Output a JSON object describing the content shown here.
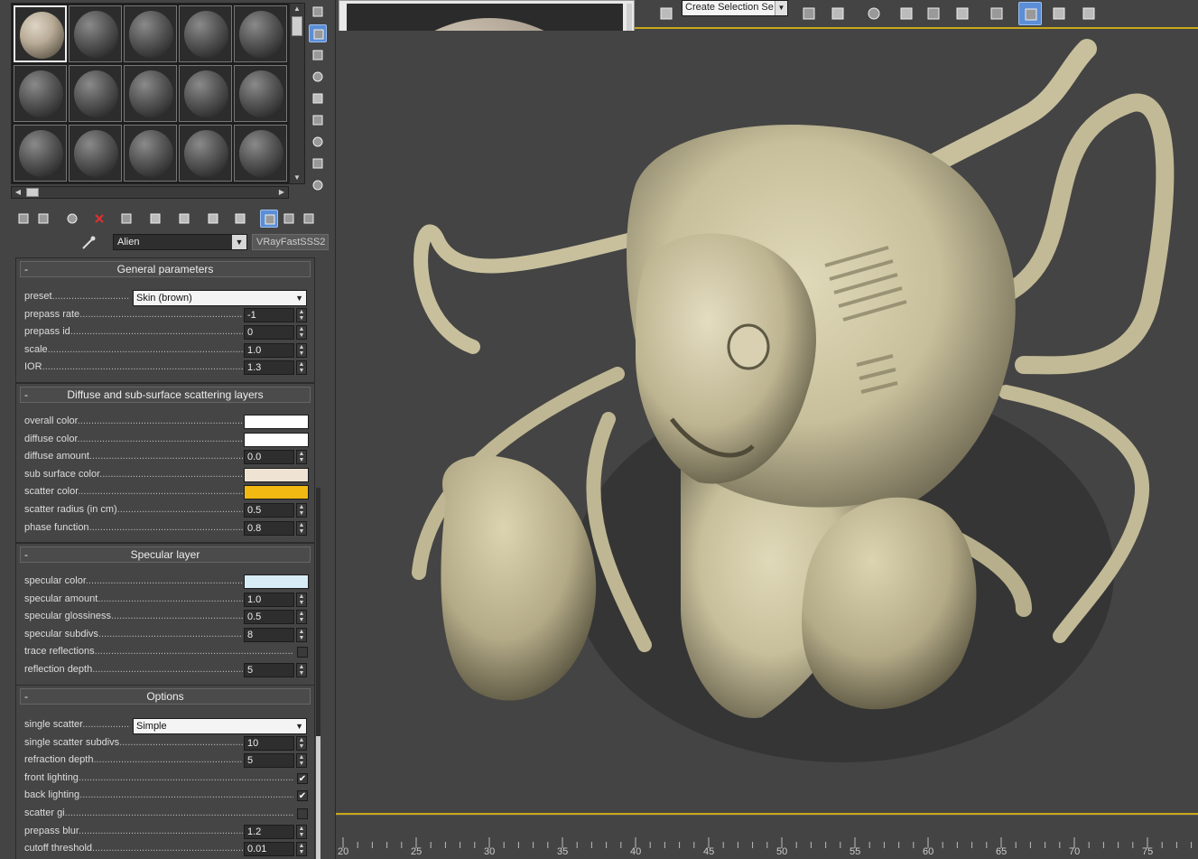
{
  "material": {
    "name": "Alien",
    "type": "VRayFastSSS2"
  },
  "rollouts": [
    {
      "title": "General parameters",
      "params": [
        {
          "label": "preset",
          "kind": "combo",
          "value": "Skin (brown)"
        },
        {
          "label": "prepass rate",
          "kind": "spinner",
          "value": "-1"
        },
        {
          "label": "prepass id",
          "kind": "spinner",
          "value": "0"
        },
        {
          "label": "scale",
          "kind": "spinner",
          "value": "1.0"
        },
        {
          "label": "IOR",
          "kind": "spinner",
          "value": "1.3"
        }
      ]
    },
    {
      "title": "Diffuse and sub-surface scattering layers",
      "params": [
        {
          "label": "overall color",
          "kind": "color",
          "color": "#ffffff"
        },
        {
          "label": "diffuse color",
          "kind": "color",
          "color": "#ffffff"
        },
        {
          "label": "diffuse amount",
          "kind": "spinner",
          "value": "0.0"
        },
        {
          "label": "sub surface color",
          "kind": "color",
          "color": "#efe3d4"
        },
        {
          "label": "scatter color",
          "kind": "color",
          "color": "#f1b912"
        },
        {
          "label": "scatter radius (in cm)",
          "kind": "spinner",
          "value": "0.5"
        },
        {
          "label": "phase function",
          "kind": "spinner",
          "value": "0.8"
        }
      ]
    },
    {
      "title": "Specular layer",
      "params": [
        {
          "label": "specular color",
          "kind": "color",
          "color": "#d8ecf6"
        },
        {
          "label": "specular amount",
          "kind": "spinner",
          "value": "1.0"
        },
        {
          "label": "specular glossiness",
          "kind": "spinner",
          "value": "0.5"
        },
        {
          "label": "specular subdivs",
          "kind": "spinner",
          "value": "8"
        },
        {
          "label": "trace reflections",
          "kind": "checkbox",
          "checked": false
        },
        {
          "label": "reflection depth",
          "kind": "spinner",
          "value": "5"
        }
      ]
    },
    {
      "title": "Options",
      "params": [
        {
          "label": "single scatter",
          "kind": "combo",
          "value": "Simple"
        },
        {
          "label": "single scatter subdivs",
          "kind": "spinner",
          "value": "10"
        },
        {
          "label": "refraction depth",
          "kind": "spinner",
          "value": "5"
        },
        {
          "label": "front lighting",
          "kind": "checkbox",
          "checked": true
        },
        {
          "label": "back lighting",
          "kind": "checkbox",
          "checked": true
        },
        {
          "label": "scatter gi",
          "kind": "checkbox",
          "checked": false
        },
        {
          "label": "prepass blur",
          "kind": "spinner",
          "value": "1.2"
        },
        {
          "label": "cutoff threshold",
          "kind": "spinner",
          "value": "0.01"
        }
      ]
    }
  ],
  "toolbar": {
    "selection_set_placeholder": "Create Selection Se",
    "collapse_label": "-"
  },
  "timeline": {
    "labels": [
      "20",
      "25",
      "30",
      "35",
      "40",
      "45",
      "50",
      "55",
      "60",
      "65",
      "70",
      "75"
    ]
  },
  "colors": {
    "accent_yellow": "#c9a818",
    "active_blue": "#5b8ed6",
    "creature": "#cfc7a6"
  },
  "icons": {
    "side_tools": [
      "sample-type-sphere-icon",
      "backlight-icon",
      "background-checker-icon",
      "sample-uv-tiling-icon",
      "video-color-check-icon",
      "make-preview-icon",
      "options-icon",
      "select-by-material-icon",
      "material-map-navigator-icon"
    ],
    "material_tools": [
      "get-material-icon",
      "put-to-scene-icon",
      "assign-to-selection-icon",
      "reset-map-icon",
      "make-copy-icon",
      "make-unique-icon",
      "put-to-library-icon",
      "material-id-icon",
      "show-shaded-material-icon",
      "show-end-result-icon",
      "go-to-parent-icon",
      "go-forward-sibling-icon"
    ],
    "toolbar": [
      "edit-named-selection-icon",
      "mirror-icon",
      "align-icon",
      "manage-layers-icon",
      "scene-explorer-icon",
      "curve-editor-icon",
      "schematic-view-icon",
      "material-editor-icon",
      "render-setup-icon",
      "rendered-frame-icon",
      "render-production-icon"
    ]
  }
}
